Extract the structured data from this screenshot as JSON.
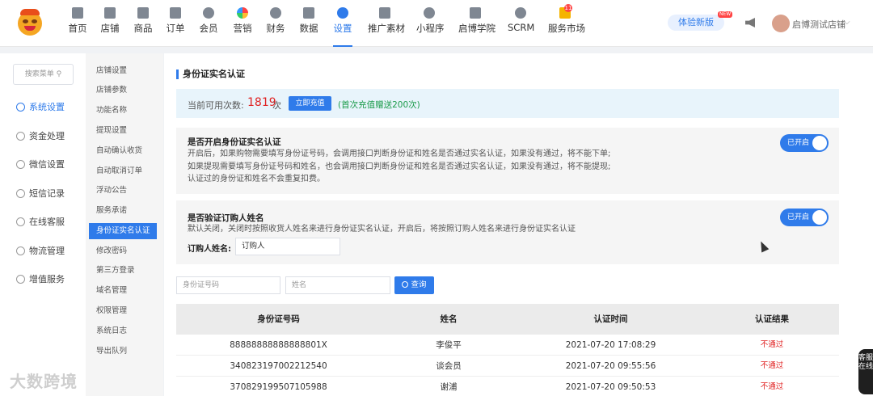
{
  "nav": {
    "items": [
      {
        "label": "首页",
        "icon": "home-icon"
      },
      {
        "label": "店铺",
        "icon": "store-icon"
      },
      {
        "label": "商品",
        "icon": "goods-icon"
      },
      {
        "label": "订单",
        "icon": "order-icon"
      },
      {
        "label": "会员",
        "icon": "member-icon"
      },
      {
        "label": "营销",
        "icon": "marketing-icon"
      },
      {
        "label": "财务",
        "icon": "finance-icon"
      },
      {
        "label": "数据",
        "icon": "data-icon"
      },
      {
        "label": "设置",
        "icon": "settings-icon"
      },
      {
        "label": "推广素材",
        "icon": "share-icon"
      },
      {
        "label": "小程序",
        "icon": "miniprogram-icon"
      },
      {
        "label": "启博学院",
        "icon": "academy-icon"
      },
      {
        "label": "SCRM",
        "icon": "scrm-icon"
      },
      {
        "label": "服务市场",
        "icon": "service-market-icon"
      }
    ],
    "service_badge": "11",
    "try_new_label": "体验新版",
    "new_tag": "NEW",
    "shop_name": "启博测试店铺",
    "accent": "#2f7bea"
  },
  "sidebar": {
    "search_placeholder": "搜索菜单",
    "items": [
      {
        "label": "系统设置"
      },
      {
        "label": "资金处理"
      },
      {
        "label": "微信设置"
      },
      {
        "label": "短信记录"
      },
      {
        "label": "在线客服"
      },
      {
        "label": "物流管理"
      },
      {
        "label": "增值服务"
      }
    ]
  },
  "submenu": {
    "items": [
      {
        "label": "店铺设置"
      },
      {
        "label": "店铺参数"
      },
      {
        "label": "功能名称"
      },
      {
        "label": "提现设置"
      },
      {
        "label": "自动确认收货"
      },
      {
        "label": "自动取消订单"
      },
      {
        "label": "浮动公告"
      },
      {
        "label": "服务承诺"
      },
      {
        "label": "身份证实名认证"
      },
      {
        "label": "修改密码"
      },
      {
        "label": "第三方登录"
      },
      {
        "label": "域名管理"
      },
      {
        "label": "权限管理"
      },
      {
        "label": "系统日志"
      },
      {
        "label": "导出队列"
      }
    ]
  },
  "main": {
    "title": "身份证实名认证",
    "count_label": "当前可用次数:",
    "count_value": "1819",
    "count_unit": "次",
    "recharge_label": "立即充值",
    "gift_note": "(首次充值赠送200次)",
    "panel1": {
      "title": "是否开启身份证实名认证",
      "lines": [
        "开启后，如果购物需要填写身份证号码，会调用接口判断身份证和姓名是否通过实名认证，如果没有通过，将不能下单;",
        "如果提现需要填写身份证号码和姓名，也会调用接口判断身份证和姓名是否通过实名认证，如果没有通过，将不能提现;",
        "认证过的身份证和姓名不会重复扣费。"
      ],
      "toggle_label": "已开启"
    },
    "panel2": {
      "title": "是否验证订购人姓名",
      "desc": "默认关闭，关闭时按照收货人姓名来进行身份证实名认证，开启后，将按照订购人姓名来进行身份证实名认证",
      "toggle_label": "已开启",
      "buyer_label": "订购人姓名:",
      "buyer_value": "订购人"
    },
    "filter": {
      "id_placeholder": "身份证号码",
      "name_placeholder": "姓名",
      "query_label": "查询"
    },
    "table": {
      "headers": [
        "身份证号码",
        "姓名",
        "认证时间",
        "认证结果"
      ],
      "rows": [
        [
          "88888888888888801X",
          "李俊平",
          "2021-07-20 17:08:29",
          "不通过"
        ],
        [
          "340823197002212540",
          "谈会员",
          "2021-07-20 09:55:56",
          "不通过"
        ],
        [
          "370829199507105988",
          "谢浦",
          "2021-07-20 09:50:53",
          "不通过"
        ]
      ]
    }
  },
  "service_tab": "客服在线",
  "watermark": "大数跨境"
}
